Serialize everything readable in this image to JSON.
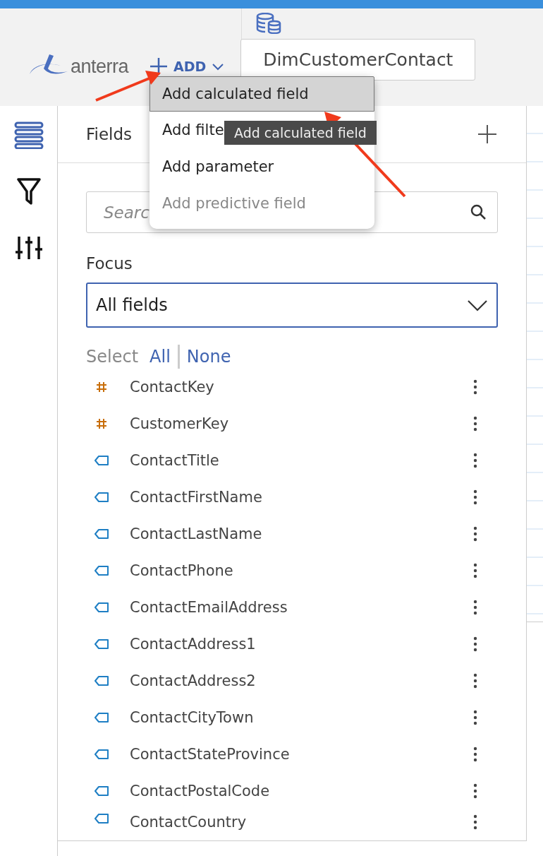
{
  "header": {
    "logo": "anterra",
    "add_button": "ADD",
    "dataset": "DimCustomerContact"
  },
  "rail": [
    {
      "kind": "fields",
      "selected": true
    },
    {
      "kind": "filter",
      "selected": false
    },
    {
      "kind": "settings",
      "selected": false
    }
  ],
  "panel": {
    "title": "Fields",
    "search": {
      "placeholder": "Searc"
    },
    "focus_label": "Focus",
    "focus_value": "All fields",
    "select_label": "Select",
    "select_all": "All",
    "select_none": "None",
    "fields": [
      {
        "name": "ContactKey",
        "kind": "measure"
      },
      {
        "name": "CustomerKey",
        "kind": "measure"
      },
      {
        "name": "ContactTitle",
        "kind": "dimension"
      },
      {
        "name": "ContactFirstName",
        "kind": "dimension"
      },
      {
        "name": "ContactLastName",
        "kind": "dimension"
      },
      {
        "name": "ContactPhone",
        "kind": "dimension"
      },
      {
        "name": "ContactEmailAddress",
        "kind": "dimension"
      },
      {
        "name": "ContactAddress1",
        "kind": "dimension"
      },
      {
        "name": "ContactAddress2",
        "kind": "dimension"
      },
      {
        "name": "ContactCityTown",
        "kind": "dimension"
      },
      {
        "name": "ContactStateProvince",
        "kind": "dimension"
      },
      {
        "name": "ContactPostalCode",
        "kind": "dimension"
      },
      {
        "name": "ContactCountry",
        "kind": "dimension"
      }
    ]
  },
  "add_menu": [
    {
      "label": "Add calculated field",
      "selected": true,
      "disabled": false
    },
    {
      "label": "Add filte",
      "selected": false,
      "disabled": false
    },
    {
      "label": "Add parameter",
      "selected": false,
      "disabled": false
    },
    {
      "label": "Add predictive field",
      "selected": false,
      "disabled": true
    }
  ],
  "tooltip": "Add calculated field"
}
